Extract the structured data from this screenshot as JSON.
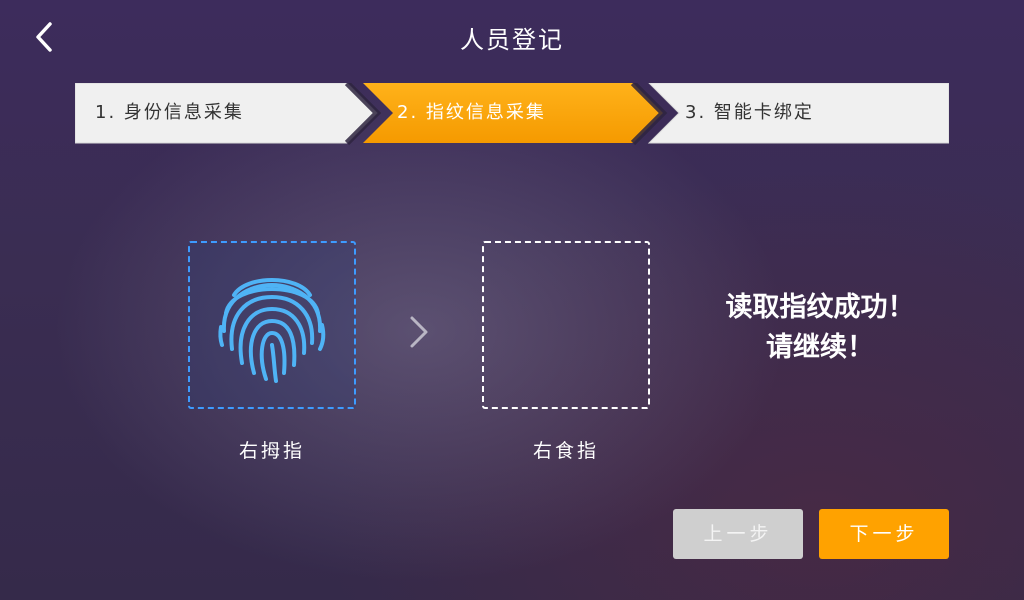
{
  "header": {
    "title": "人员登记"
  },
  "steps": [
    {
      "label": "1. 身份信息采集",
      "state": "inactive"
    },
    {
      "label": "2. 指纹信息采集",
      "state": "active"
    },
    {
      "label": "3. 智能卡绑定",
      "state": "inactive"
    }
  ],
  "fingers": [
    {
      "label": "右拇指",
      "status": "captured",
      "icon": "fingerprint-icon"
    },
    {
      "label": "右食指",
      "status": "pending"
    }
  ],
  "message": {
    "line1": "读取指纹成功！",
    "line2": "请继续！"
  },
  "buttons": {
    "prev_label": "上一步",
    "next_label": "下一步"
  },
  "colors": {
    "accent": "#ffa200",
    "fingerprint": "#4fb3f5",
    "step_inactive_bg": "#f0f0f0",
    "disabled_button": "#cfcfcf"
  }
}
